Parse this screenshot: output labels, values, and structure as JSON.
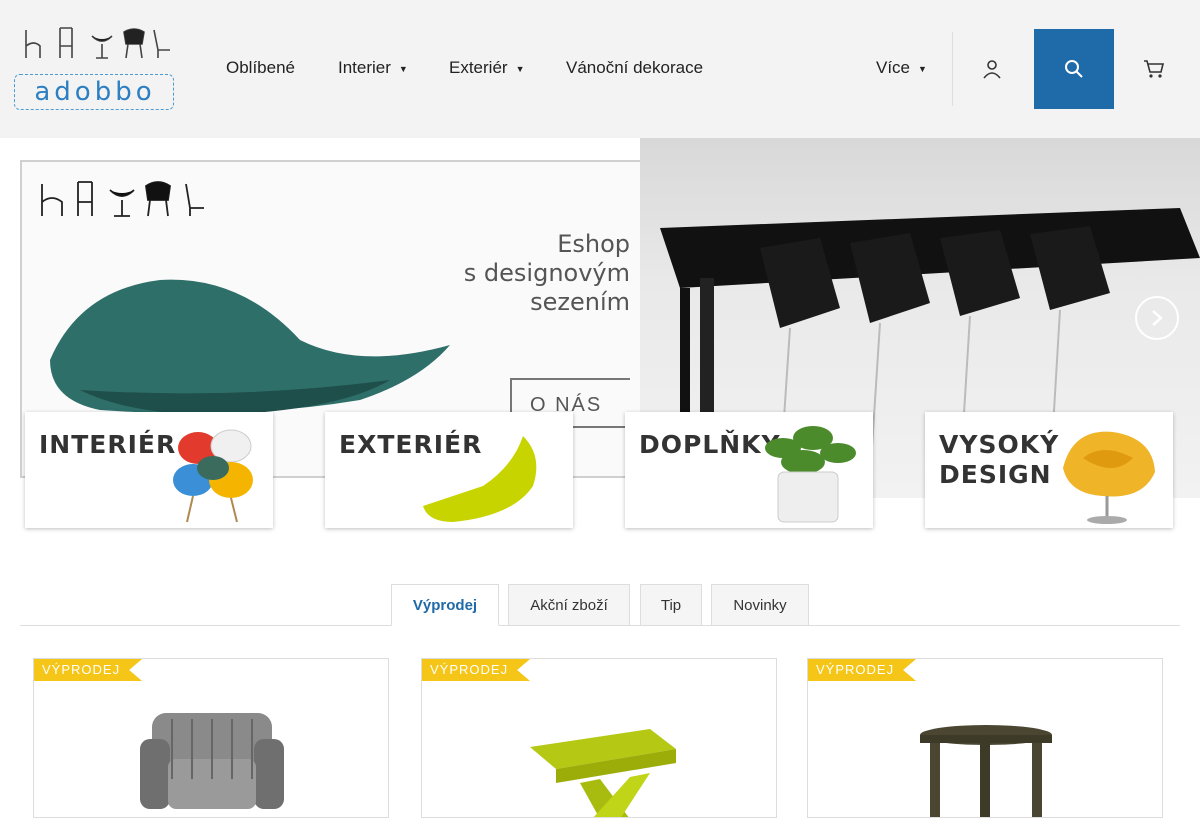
{
  "header": {
    "nav": [
      {
        "label": "Oblíbené"
      },
      {
        "label": "Interier"
      },
      {
        "label": "Exteriér"
      },
      {
        "label": "Vánoční dekorace"
      },
      {
        "label": "Více"
      }
    ],
    "logo_text": "adobbo",
    "icons": {
      "user": "user-icon",
      "search": "search-icon",
      "cart": "cart-icon"
    },
    "accent_color": "#1f6aa8"
  },
  "banner": {
    "slogan_lines": [
      "Eshop",
      "s designovým",
      "sezením"
    ],
    "about_button": "O NÁS",
    "categories": [
      {
        "label": "INTERIÉR"
      },
      {
        "label": "EXTERIÉR"
      },
      {
        "label": "DOPLŇKY"
      },
      {
        "label": "VYSOKÝ DESIGN"
      }
    ]
  },
  "tabs": [
    {
      "label": "Výprodej",
      "active": true
    },
    {
      "label": "Akční zboží",
      "active": false
    },
    {
      "label": "Tip",
      "active": false
    },
    {
      "label": "Novinky",
      "active": false
    }
  ],
  "products": [
    {
      "badge": "VÝPRODEJ"
    },
    {
      "badge": "VÝPRODEJ"
    },
    {
      "badge": "VÝPRODEJ"
    }
  ],
  "badge_color": "#f5c518"
}
